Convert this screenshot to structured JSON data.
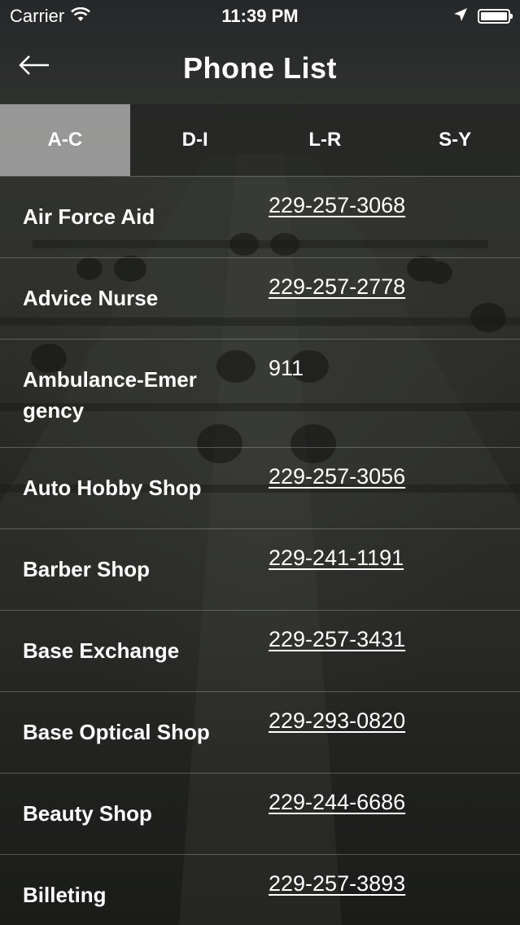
{
  "status_bar": {
    "carrier": "Carrier",
    "time": "11:39 PM",
    "battery_level": 1.0
  },
  "nav": {
    "title": "Phone List",
    "back_icon": "arrow-left-icon"
  },
  "tabs": [
    {
      "label": "A-C",
      "active": true
    },
    {
      "label": "D-I",
      "active": false
    },
    {
      "label": "L-R",
      "active": false
    },
    {
      "label": "S-Y",
      "active": false
    }
  ],
  "entries": [
    {
      "name": "Air Force Aid",
      "phone": "229-257-3068",
      "link": true
    },
    {
      "name": "Advice Nurse",
      "phone": "229-257-2778",
      "link": true
    },
    {
      "name": "Ambulance-Emergency",
      "phone": "911",
      "link": false
    },
    {
      "name": "Auto Hobby Shop",
      "phone": "229-257-3056",
      "link": true
    },
    {
      "name": "Barber Shop",
      "phone": "229-241-1191",
      "link": true
    },
    {
      "name": "Base Exchange",
      "phone": "229-257-3431",
      "link": true
    },
    {
      "name": "Base Optical Shop",
      "phone": "229-293-0820",
      "link": true
    },
    {
      "name": "Beauty Shop",
      "phone": "229-244-6686",
      "link": true
    },
    {
      "name": "Billeting",
      "phone": "229-257-3893",
      "link": true
    }
  ]
}
